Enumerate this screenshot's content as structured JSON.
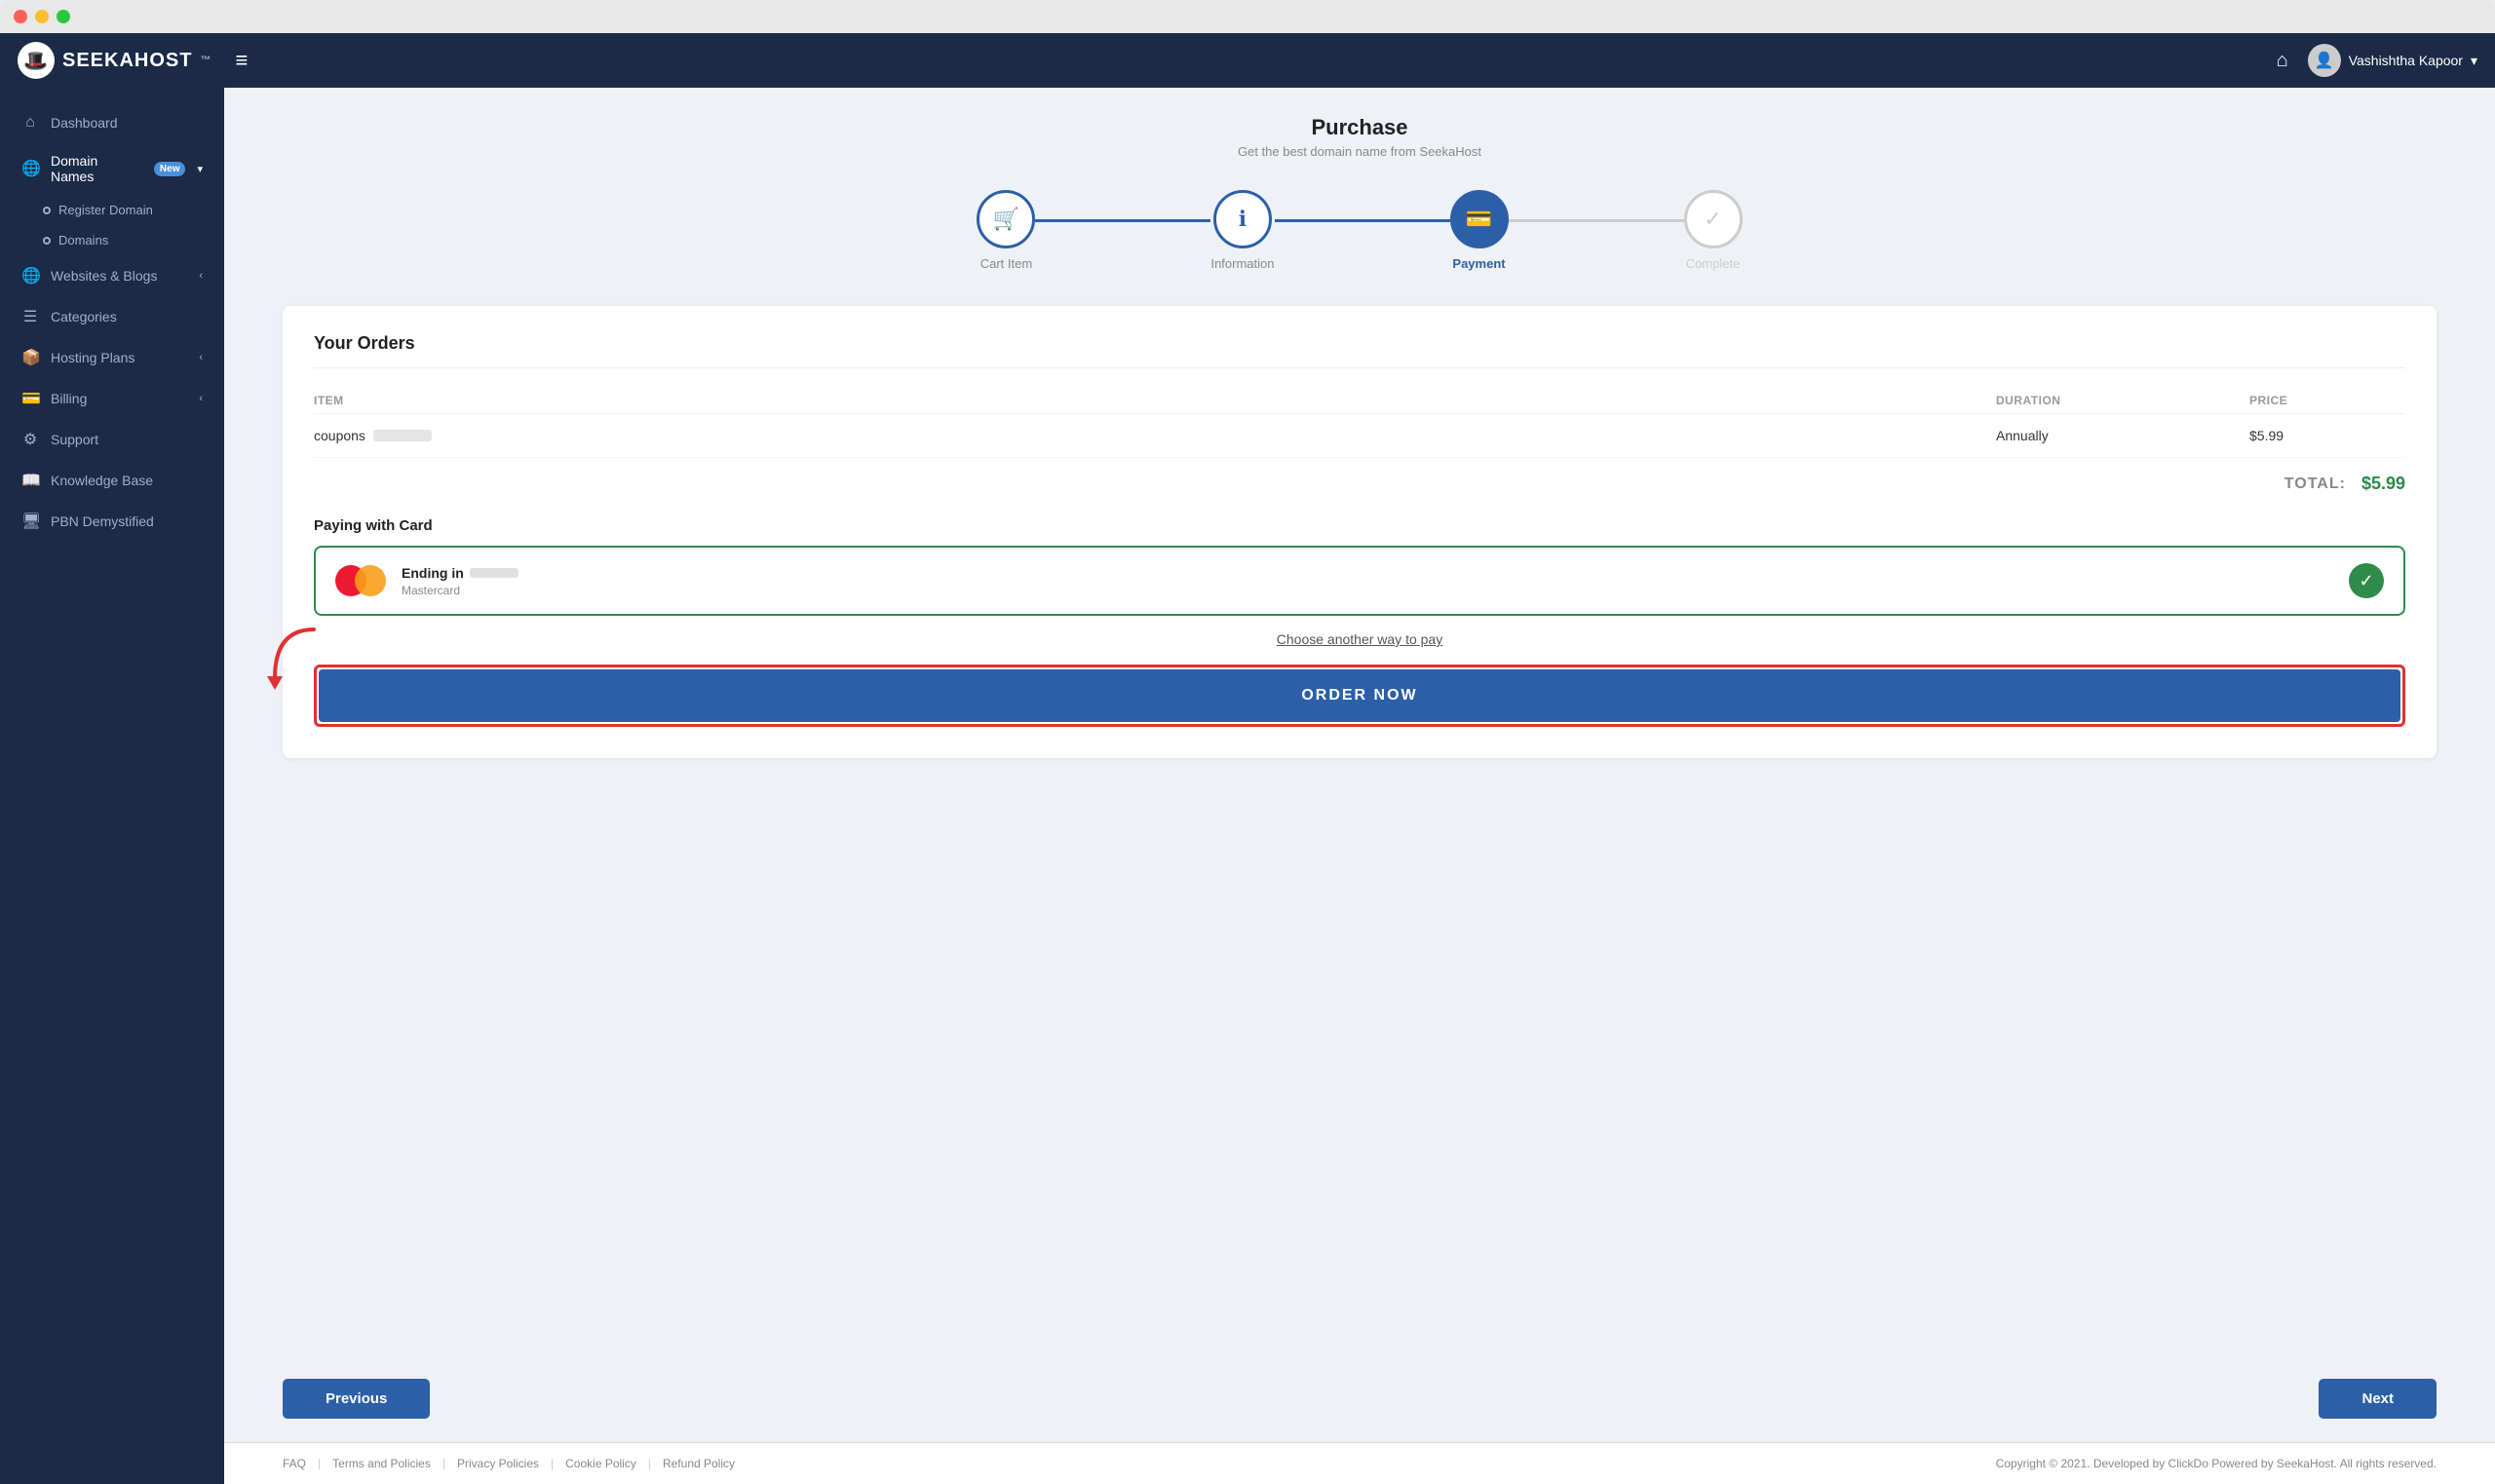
{
  "window": {
    "chrome_dots": [
      "red",
      "yellow",
      "green"
    ]
  },
  "topbar": {
    "logo_text": "SEEKAHOST",
    "logo_icon": "🎩",
    "hamburger": "≡",
    "home_icon": "⌂",
    "user_name": "Vashishtha Kapoor",
    "user_icon": "👤",
    "dropdown_arrow": "▾"
  },
  "sidebar": {
    "items": [
      {
        "id": "dashboard",
        "icon": "⌂",
        "label": "Dashboard",
        "active": false
      },
      {
        "id": "domain-names",
        "icon": "🌐",
        "label": "Domain Names",
        "active": true,
        "badge": "New",
        "arrow": "▾"
      },
      {
        "id": "register-domain",
        "sub": true,
        "label": "Register Domain"
      },
      {
        "id": "domains",
        "sub": true,
        "label": "Domains"
      },
      {
        "id": "websites-blogs",
        "icon": "🌐",
        "label": "Websites & Blogs",
        "active": false,
        "arrow": "‹"
      },
      {
        "id": "categories",
        "icon": "☰",
        "label": "Categories",
        "active": false
      },
      {
        "id": "hosting-plans",
        "icon": "📦",
        "label": "Hosting Plans",
        "active": false,
        "arrow": "‹"
      },
      {
        "id": "billing",
        "icon": "💳",
        "label": "Billing",
        "active": false,
        "arrow": "‹"
      },
      {
        "id": "support",
        "icon": "⚙",
        "label": "Support",
        "active": false
      },
      {
        "id": "knowledge-base",
        "icon": "📖",
        "label": "Knowledge Base",
        "active": false
      },
      {
        "id": "pbn-demystified",
        "icon": "🖥",
        "label": "PBN Demystified",
        "active": false
      }
    ]
  },
  "purchase": {
    "title": "Purchase",
    "subtitle": "Get the best domain name from SeekaHost",
    "steps": [
      {
        "id": "cart",
        "icon": "🛒",
        "label": "Cart Item",
        "state": "done"
      },
      {
        "id": "information",
        "icon": "ℹ",
        "label": "Information",
        "state": "done"
      },
      {
        "id": "payment",
        "icon": "💳",
        "label": "Payment",
        "state": "active"
      },
      {
        "id": "complete",
        "icon": "✓",
        "label": "Complete",
        "state": "inactive"
      }
    ],
    "order_card": {
      "title": "Your Orders",
      "table_headers": {
        "item": "ITEM",
        "duration": "DURATION",
        "price": "PRICE"
      },
      "rows": [
        {
          "item_prefix": "coupons",
          "item_blurred": true,
          "duration": "Annually",
          "price": "$5.99"
        }
      ],
      "total_label": "TOTAL:",
      "total_amount": "$5.99"
    },
    "payment": {
      "paying_label": "Paying with Card",
      "card_ending_label": "Ending in",
      "card_type": "Mastercard",
      "check": true,
      "choose_another": "Choose another way to pay"
    },
    "order_now_btn": "ORDER NOW",
    "previous_btn": "Previous",
    "next_btn": "Next"
  },
  "footer": {
    "links": [
      "FAQ",
      "Terms and Policies",
      "Privacy Policies",
      "Cookie Policy",
      "Refund Policy"
    ],
    "copyright": "Copyright © 2021. Developed by ClickDo Powered by SeekaHost. All rights reserved."
  }
}
